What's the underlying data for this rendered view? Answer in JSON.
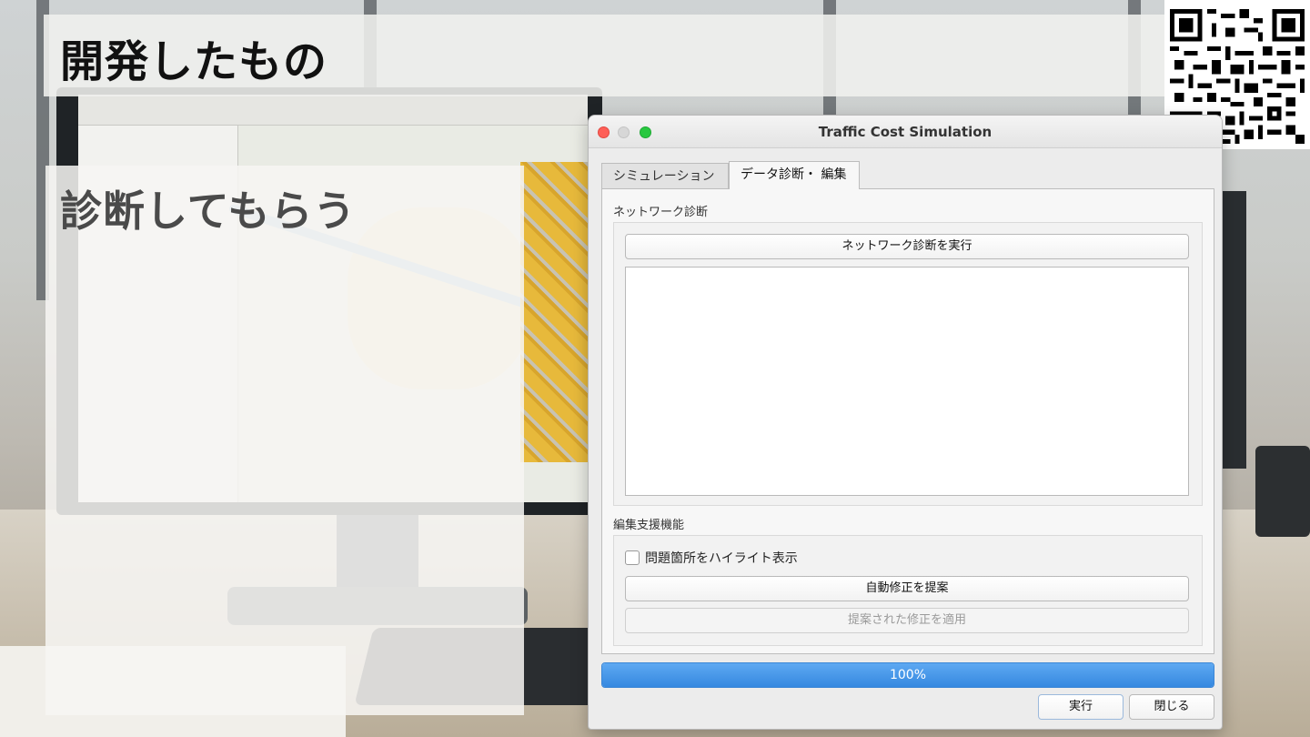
{
  "slide": {
    "title": "開発したもの",
    "subtitle": "診断してもらう"
  },
  "dialog": {
    "window_title": "Traffic Cost Simulation",
    "tabs": [
      {
        "label": "シミュレーション",
        "active": false
      },
      {
        "label": "データ診断・ 編集",
        "active": true
      }
    ],
    "network_group": {
      "label": "ネットワーク診断",
      "run_button": "ネットワーク診断を実行",
      "output_text": ""
    },
    "edit_group": {
      "label": "編集支援機能",
      "highlight_checkbox": {
        "label": "問題箇所をハイライト表示",
        "checked": false
      },
      "suggest_button": "自動修正を提案",
      "apply_button": {
        "label": "提案された修正を適用",
        "enabled": false
      }
    },
    "progress": {
      "value": 1.0,
      "text": "100%"
    },
    "footer": {
      "run_button": "実行",
      "close_button": "閉じる"
    }
  },
  "colors": {
    "accent": "#3588e0",
    "close_light": "#fe5f57",
    "minimize_light": "#d7d7d7",
    "zoom_light": "#28c840",
    "map_district": "#e7b93b"
  },
  "icons": [
    "qr-code-icon",
    "checkbox-icon"
  ]
}
